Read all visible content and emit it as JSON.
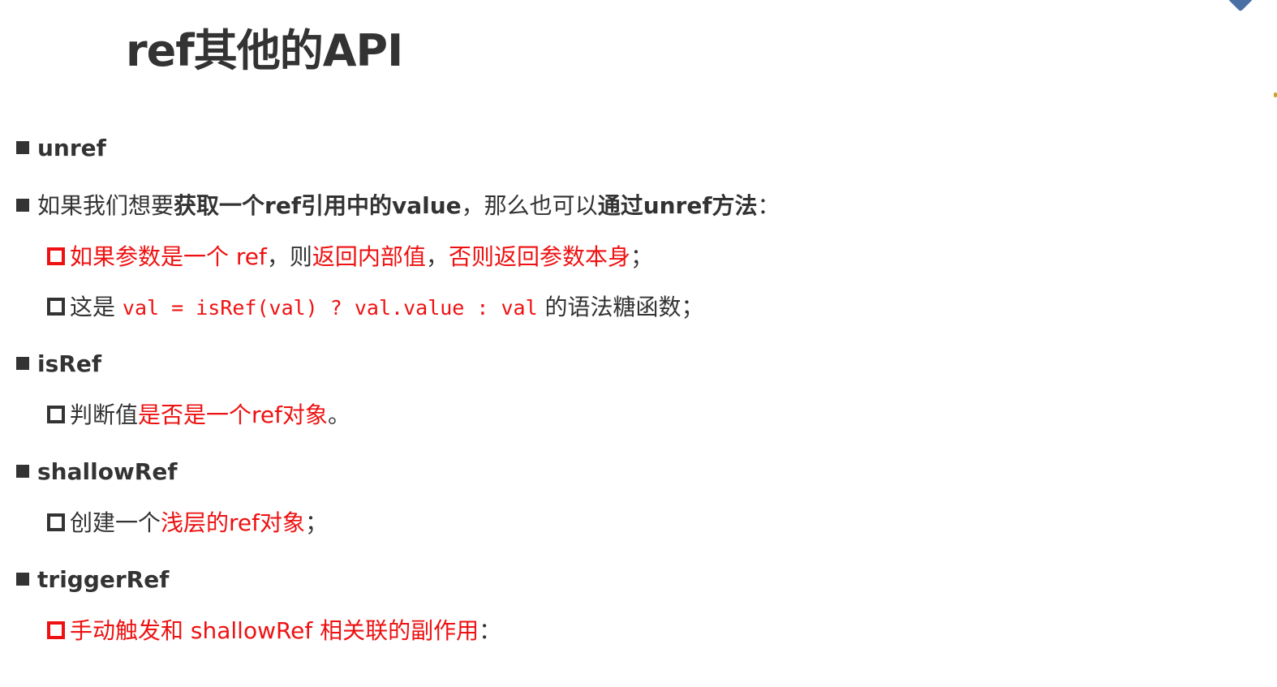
{
  "title": "ref其他的API",
  "unref": {
    "heading": "unref",
    "desc": {
      "p1": "如果我们想要",
      "p2": "获取一个ref引用中的value",
      "p3": "，那么也可以",
      "p4": "通过unref方法",
      "p5": "："
    },
    "sub1": {
      "p1": "如果参数是一个 ref",
      "p2": "，则",
      "p3": "返回内部值",
      "p4": "，",
      "p5": "否则返回参数本身",
      "p6": "；"
    },
    "sub2": {
      "p1": "这是 ",
      "code": "val = isRef(val) ? val.value : val",
      "p2": " 的语法糖函数；"
    }
  },
  "isRef": {
    "heading": "isRef",
    "sub1": {
      "p1": "判断值",
      "p2": "是否是一个ref对象",
      "p3": "。"
    }
  },
  "shallowRef": {
    "heading": "shallowRef",
    "sub1": {
      "p1": "创建一个",
      "p2": "浅层的ref对象",
      "p3": "；"
    }
  },
  "triggerRef": {
    "heading": "triggerRef",
    "sub1": {
      "p1": "手动触发和 shallowRef 相关联的副作用",
      "p2": "："
    }
  },
  "colors": {
    "text": "#333333",
    "accent_red": "#ee1111",
    "corner_mark": "#4a6fa5"
  }
}
